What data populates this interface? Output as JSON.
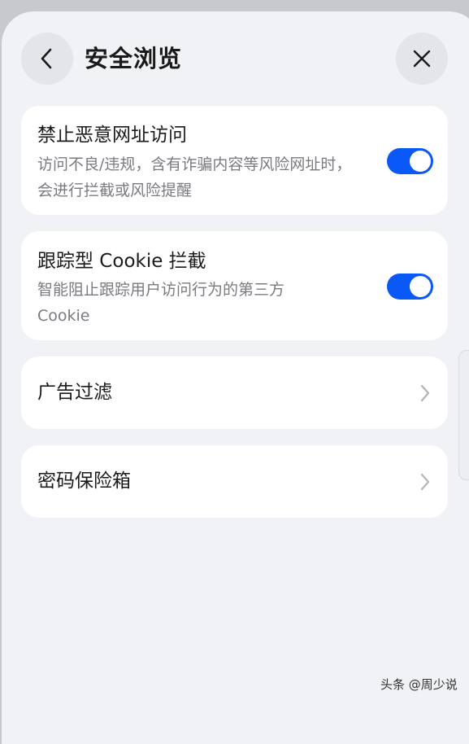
{
  "header": {
    "title": "安全浏览",
    "back_icon": "chevron-left-icon",
    "close_icon": "close-icon"
  },
  "settings": [
    {
      "title": "禁止恶意网址访问",
      "description": "访问不良/违规，含有诈骗内容等风险网址时，会进行拦截或风险提醒",
      "control": "toggle",
      "enabled": true
    },
    {
      "title": "跟踪型 Cookie 拦截",
      "description": "智能阻止跟踪用户访问行为的第三方Cookie",
      "control": "toggle",
      "enabled": true
    },
    {
      "title": "广告过滤",
      "control": "chevron"
    },
    {
      "title": "密码保险箱",
      "control": "chevron"
    }
  ],
  "colors": {
    "accent": "#0a59f7",
    "background": "#f1f2f5",
    "card": "#ffffff",
    "title_text": "#1a1a1a",
    "secondary_text": "#7a7b80"
  },
  "watermark": "头条 @周少说"
}
